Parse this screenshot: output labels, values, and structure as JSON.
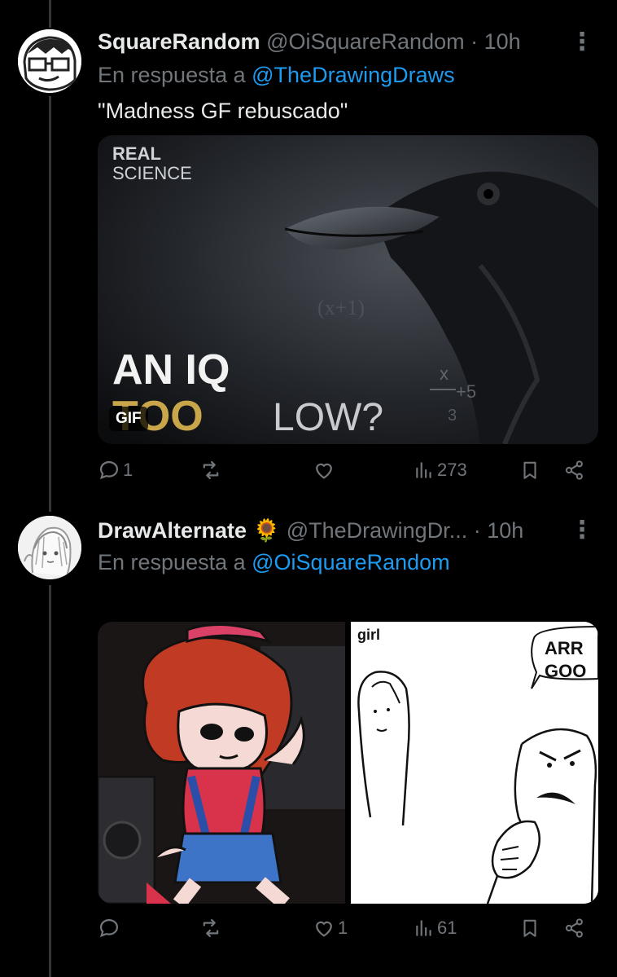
{
  "tweets": [
    {
      "name": "SquareRandom",
      "handle": "@OiSquareRandom",
      "sep": "·",
      "time": "10h",
      "reply_prefix": "En respuesta a",
      "reply_to": "@TheDrawingDraws",
      "text": "\"Madness GF rebuscado\"",
      "media": {
        "brand_top": "REAL",
        "brand_bottom": "SCIENCE",
        "line1": "AN IQ",
        "line2a": "TOO",
        "line2b": "LOW?",
        "gif_label": "GIF"
      },
      "stats": {
        "replies": "1",
        "retweets": "",
        "likes": "",
        "views": "273"
      }
    },
    {
      "name": "DrawAlternate",
      "emoji": "🌻",
      "handle": "@TheDrawingDr...",
      "sep": "·",
      "time": "10h",
      "reply_prefix": "En respuesta a",
      "reply_to": "@OiSquareRandom",
      "media": {
        "comic_label_girl": "girl",
        "comic_speech_1": "ARR",
        "comic_speech_2": "GOO"
      },
      "stats": {
        "replies": "",
        "retweets": "",
        "likes": "1",
        "views": "61"
      }
    }
  ],
  "colors": {
    "accent": "#1d9bf0",
    "muted": "#71767b",
    "text": "#e7e9ea",
    "background": "#000000"
  }
}
